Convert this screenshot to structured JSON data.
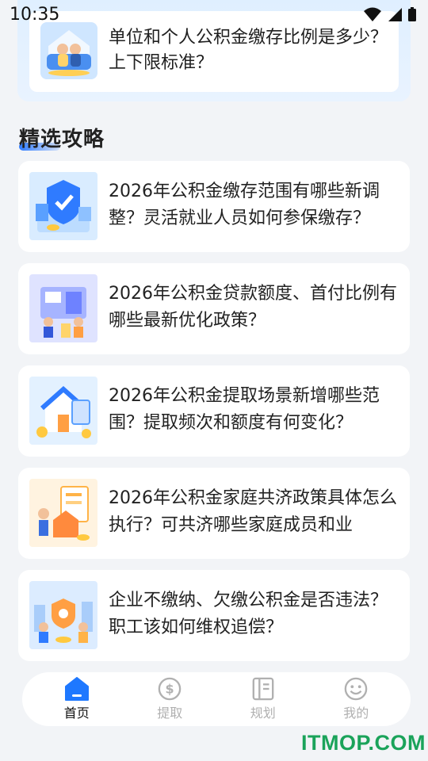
{
  "status_bar": {
    "time": "10:35"
  },
  "top_card": {
    "title": "单位和个人公积金缴存比例是多少？上下限标准？"
  },
  "section": {
    "title": "精选攻略"
  },
  "articles": [
    {
      "title": "2026年公积金缴存范围有哪些新调整？灵活就业人员如何参保缴存？"
    },
    {
      "title": "2026年公积金贷款额度、首付比例有哪些最新优化政策？"
    },
    {
      "title": "2026年公积金提取场景新增哪些范围？提取频次和额度有何变化？"
    },
    {
      "title": "2026年公积金家庭共济政策具体怎么执行？可共济哪些家庭成员和业"
    },
    {
      "title": "企业不缴纳、欠缴公积金是否违法？职工该如何维权追偿？"
    }
  ],
  "bottom_nav": [
    {
      "label": "首页",
      "icon": "home-icon",
      "active": true
    },
    {
      "label": "提取",
      "icon": "dollar-coin-icon",
      "active": false
    },
    {
      "label": "规划",
      "icon": "notebook-icon",
      "active": false
    },
    {
      "label": "我的",
      "icon": "smiley-icon",
      "active": false
    }
  ],
  "colors": {
    "accent": "#1e78ff",
    "inactive": "#b0b0b0",
    "watermark": "#1aa35a"
  },
  "watermark": "ITMOP.COM"
}
